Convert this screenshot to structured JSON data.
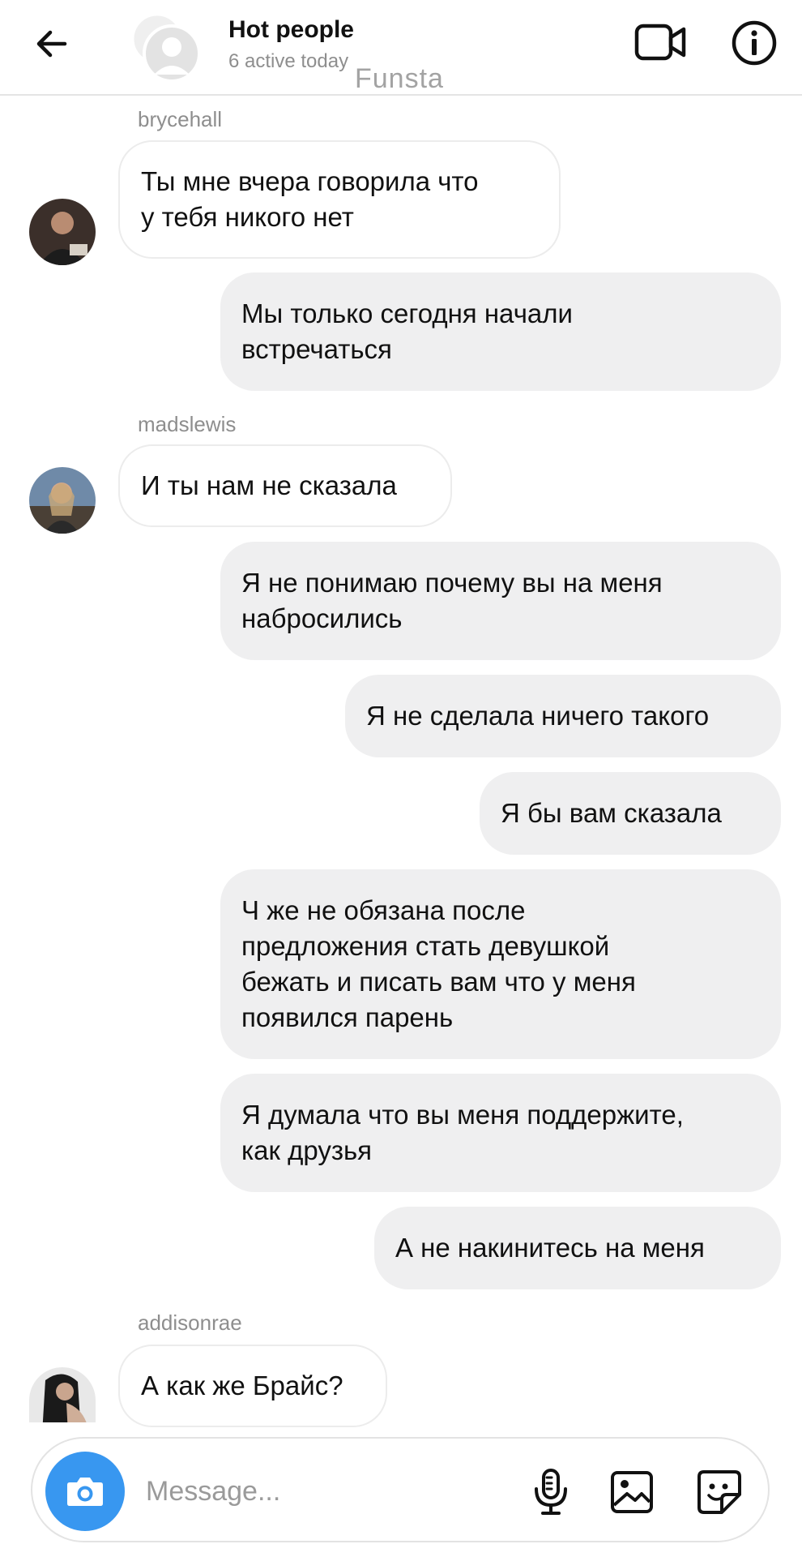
{
  "header": {
    "title": "Hot people",
    "subtitle": "6 active today",
    "watermark": "Funsta"
  },
  "messages": {
    "m1": {
      "sender": "brycehall",
      "text": "Ты мне вчера говорила что\nу тебя никого нет"
    },
    "m2": {
      "text": "Мы только сегодня начали\nвстречаться"
    },
    "m3": {
      "sender": "madslewis",
      "text": "И ты нам не сказала"
    },
    "m4": {
      "text": "Я не понимаю почему вы на меня\nнабросились"
    },
    "m5": {
      "text": "Я не сделала ничего такого"
    },
    "m6": {
      "text": "Я бы вам сказала"
    },
    "m7": {
      "text": "Ч же не обязана после\nпредложения стать девушкой\nбежать и писать вам что у меня\nпоявился парень"
    },
    "m8": {
      "text": "Я думала что вы меня поддержите,\nкак друзья"
    },
    "m9": {
      "text": "А не накинитесь на  меня"
    },
    "m10": {
      "sender": "addisonrae",
      "text": "А как же Брайс?"
    }
  },
  "composer": {
    "placeholder": "Message..."
  },
  "colors": {
    "accent": "#3897f0",
    "outgoing_bubble": "#efeff0",
    "incoming_border": "#ececec",
    "secondary_text": "#8e8e8e"
  },
  "icons": [
    "back-arrow-icon",
    "group-avatar-icon",
    "video-call-icon",
    "info-icon",
    "camera-icon",
    "microphone-icon",
    "gallery-icon",
    "sticker-icon"
  ]
}
